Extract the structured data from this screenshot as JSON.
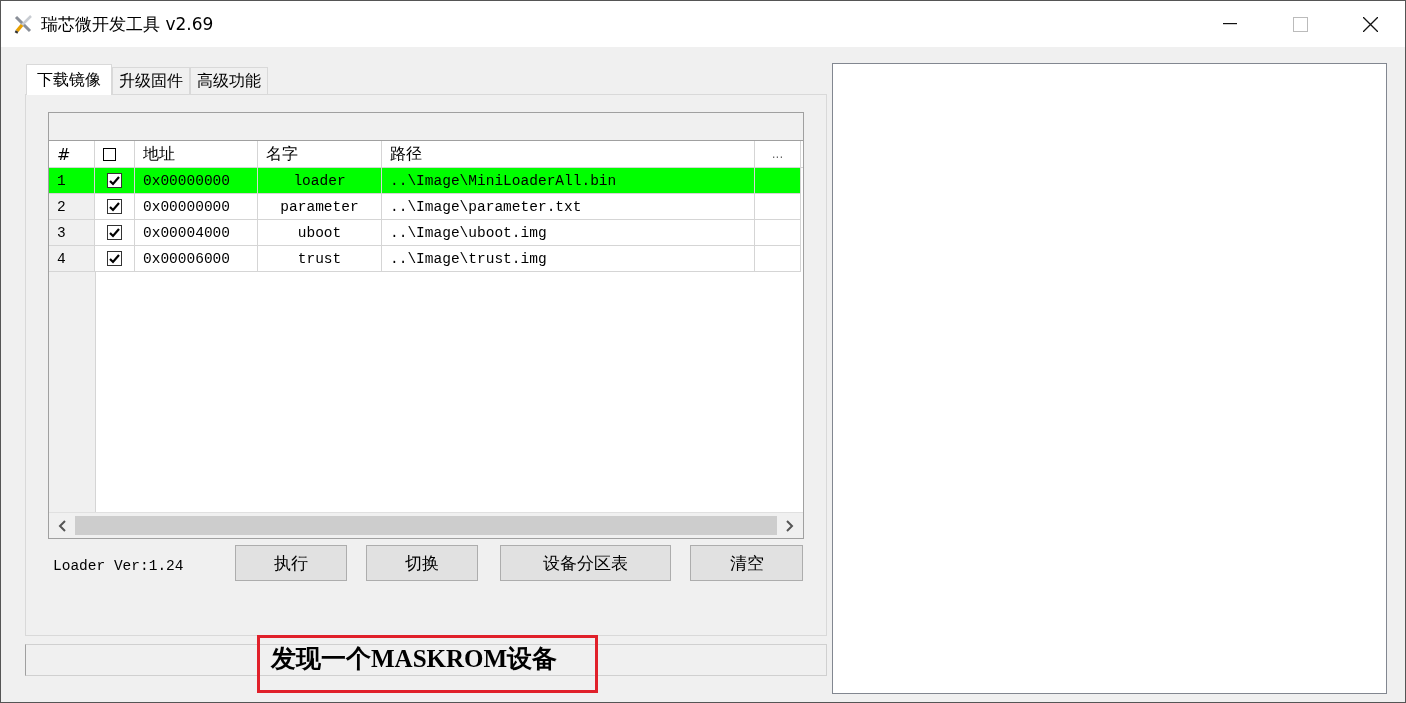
{
  "window": {
    "title": "瑞芯微开发工具 v2.69"
  },
  "tabs": [
    {
      "label": "下载镜像",
      "selected": true
    },
    {
      "label": "升级固件",
      "selected": false
    },
    {
      "label": "高级功能",
      "selected": false
    }
  ],
  "table": {
    "columns": [
      "#",
      "地址",
      "名字",
      "路径",
      "..."
    ],
    "header_checked": false,
    "rows": [
      {
        "index": "1",
        "checked": true,
        "selected": true,
        "address": "0x00000000",
        "name": "loader",
        "path": "..\\Image\\MiniLoaderAll.bin"
      },
      {
        "index": "2",
        "checked": true,
        "selected": false,
        "address": "0x00000000",
        "name": "parameter",
        "path": "..\\Image\\parameter.txt"
      },
      {
        "index": "3",
        "checked": true,
        "selected": false,
        "address": "0x00004000",
        "name": "uboot",
        "path": "..\\Image\\uboot.img"
      },
      {
        "index": "4",
        "checked": true,
        "selected": false,
        "address": "0x00006000",
        "name": "trust",
        "path": "..\\Image\\trust.img"
      }
    ]
  },
  "loader_version": "Loader Ver:1.24",
  "buttons": [
    "执行",
    "切换",
    "设备分区表",
    "清空"
  ],
  "status_bar": {
    "text": "发现一个MASKROM设备",
    "highlighted": true
  }
}
